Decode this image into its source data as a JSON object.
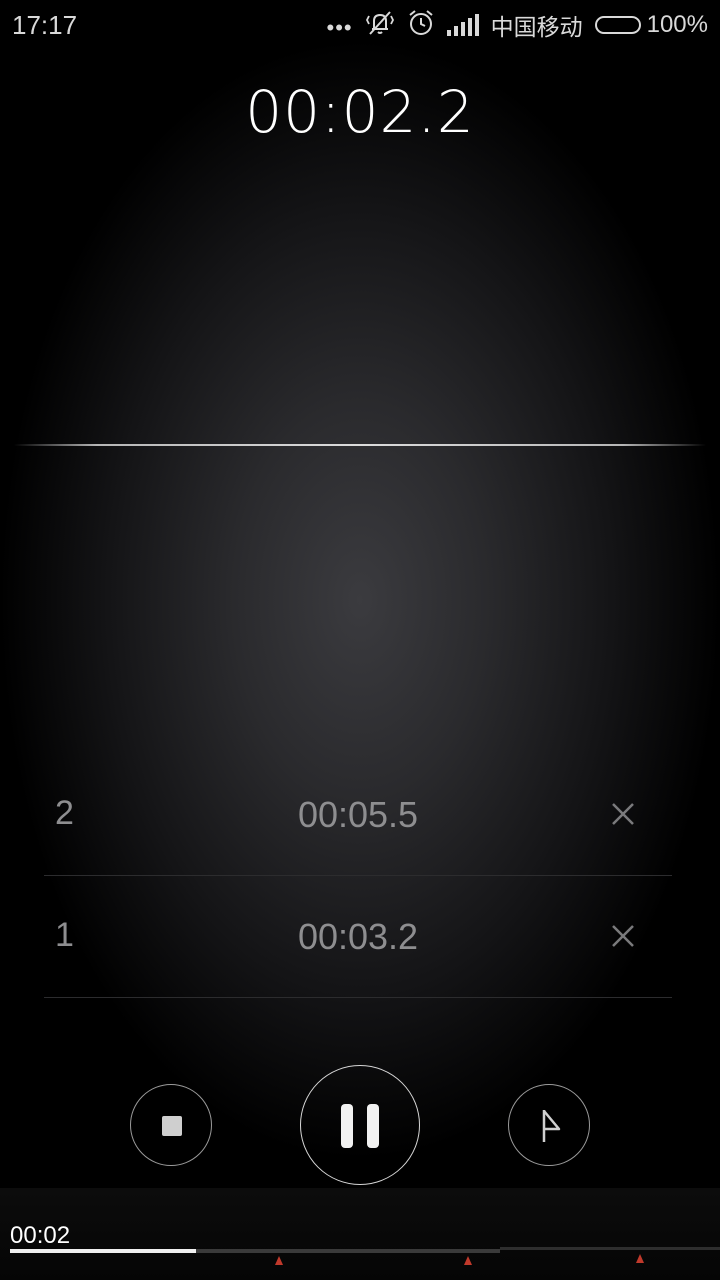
{
  "status_bar": {
    "time": "17:17",
    "carrier": "中国移动",
    "battery_percent": "100%",
    "icons": [
      "more-dots-icon",
      "vibrate-silent-icon",
      "alarm-clock-icon",
      "signal-icon",
      "battery-icon"
    ]
  },
  "stopwatch": {
    "current_time": "00:02.2"
  },
  "laps": [
    {
      "number": "2",
      "time": "00:05.5"
    },
    {
      "number": "1",
      "time": "00:03.2"
    }
  ],
  "controls": {
    "stop_icon": "stop-icon",
    "pause_icon": "pause-icon",
    "lap_icon": "lap-flag-icon"
  },
  "progress": {
    "elapsed_label": "00:02",
    "fraction": 0.265
  },
  "colors": {
    "accent_marker": "#c0392b",
    "text_primary": "#ffffff",
    "text_secondary": "#8e8e90"
  }
}
